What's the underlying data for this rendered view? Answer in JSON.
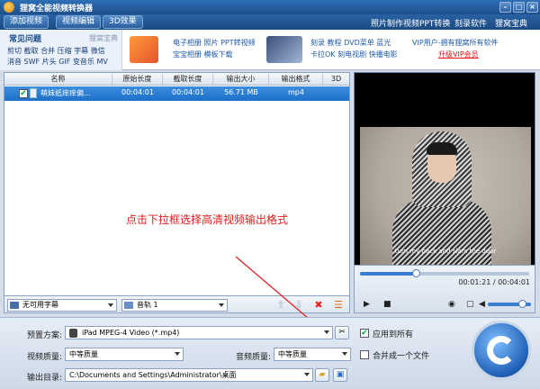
{
  "window": {
    "title": "狸窝全能视频转换器"
  },
  "menu": {
    "tabs": [
      "添加视频",
      "视频编辑",
      "3D效果"
    ],
    "right_links": [
      "照片制作视频",
      "PPT转换",
      "刻录软件",
      "狸窝宝典"
    ]
  },
  "banner": {
    "faq_title": "常见问题",
    "faq_brand": "狸窝宝典",
    "faq_lines": [
      "剪切 截取 合并 压缩 字幕 微信",
      "消音 SWF 片头 GIF 变音乐 MV"
    ],
    "ad1": [
      "电子相册 照片 PPT转视频",
      "宝宝相册 模板下载"
    ],
    "ad2": [
      "刻录 教程 DVD菜单 蓝光",
      "卡拉OK 刻电视剧 快播电影"
    ],
    "vip": "VIP用户-拥有狸窝所有软件",
    "vip_link": "升级VIP会员"
  },
  "table": {
    "headers": [
      "名称",
      "原始长度",
      "截取长度",
      "输出大小",
      "输出格式",
      "3D"
    ],
    "rows": [
      {
        "checked": "✔",
        "name": "萌妹纸痒痒偏...",
        "original": "00:04:01",
        "trim": "00:04:01",
        "size": "56.71 MB",
        "format": "mp4",
        "three_d": ""
      }
    ]
  },
  "bottom": {
    "subtitle": "无可用字幕",
    "audio": "音轨 1"
  },
  "preview": {
    "caption": "turn my back and slam the door",
    "time": "00:01:21 / 00:04:01",
    "progress": 0.33,
    "volume": 0.8
  },
  "annotation": "点击下拉框选择高清视频输出格式",
  "options": {
    "preset_label": "预置方案:",
    "preset_value": "iPad MPEG-4 Video (*.mp4)",
    "apply_all": "应用到所有",
    "apply_all_checked": "✔",
    "video_quality_label": "视频质量:",
    "video_quality_value": "中等质量",
    "audio_quality_label": "音频质量:",
    "audio_quality_value": "中等质量",
    "merge_label": "合并成一个文件",
    "output_label": "输出目录:",
    "output_value": "C:\\Documents and Settings\\Administrator\\桌面"
  },
  "colors": {
    "accent": "#1e6fc8",
    "annotation": "#e21d1d"
  }
}
